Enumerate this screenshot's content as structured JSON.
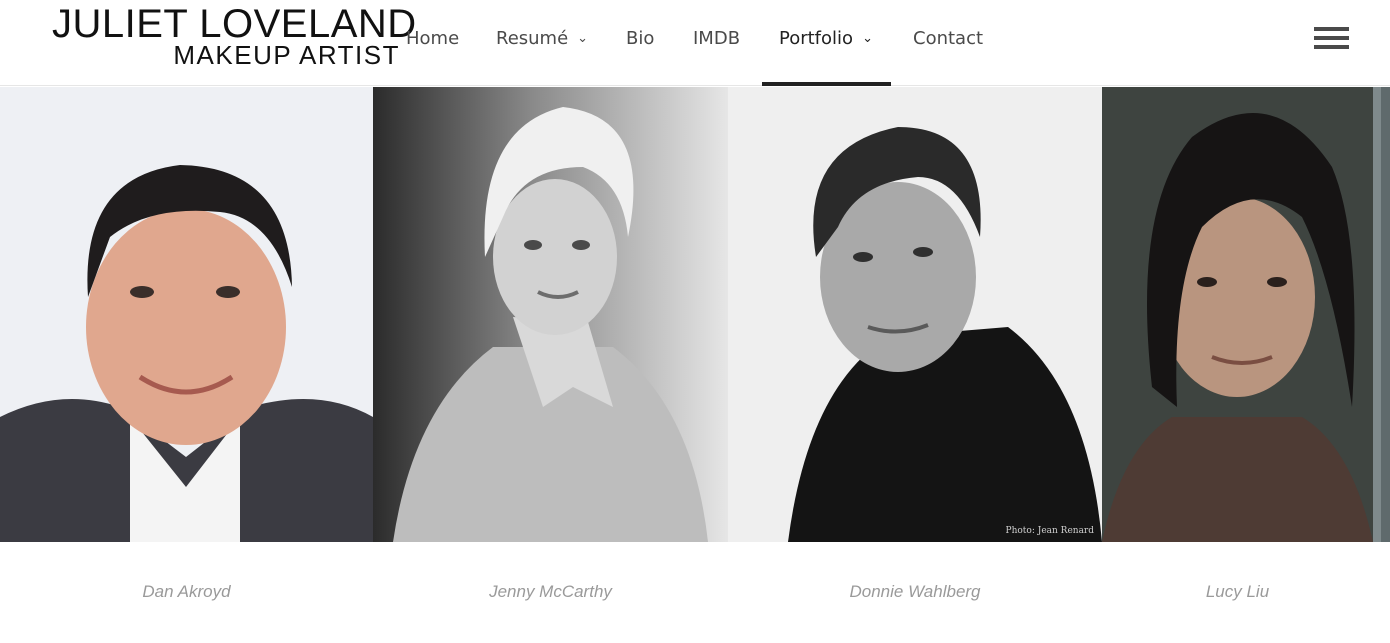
{
  "brand": {
    "name_line1": "JULIET LOVELAND",
    "name_line2": "MAKEUP ARTIST"
  },
  "nav": {
    "items": [
      {
        "label": "Home",
        "has_dropdown": false,
        "active": false
      },
      {
        "label": "Resumé",
        "has_dropdown": true,
        "active": false
      },
      {
        "label": "Bio",
        "has_dropdown": false,
        "active": false
      },
      {
        "label": "IMDB",
        "has_dropdown": false,
        "active": false
      },
      {
        "label": "Portfolio",
        "has_dropdown": true,
        "active": true
      },
      {
        "label": "Contact",
        "has_dropdown": false,
        "active": false
      }
    ],
    "menu_icon": "hamburger-icon"
  },
  "gallery": {
    "items": [
      {
        "name": "Dan Akroyd"
      },
      {
        "name": "Jenny McCarthy"
      },
      {
        "name": "Donnie Wahlberg",
        "photo_credit": "Photo: Jean Renard"
      },
      {
        "name": "Lucy Liu"
      }
    ]
  },
  "colors": {
    "text_dark": "#111111",
    "nav_text": "#4a4a4a",
    "active_underline": "#222222",
    "caption_text": "#9a9a9a"
  }
}
